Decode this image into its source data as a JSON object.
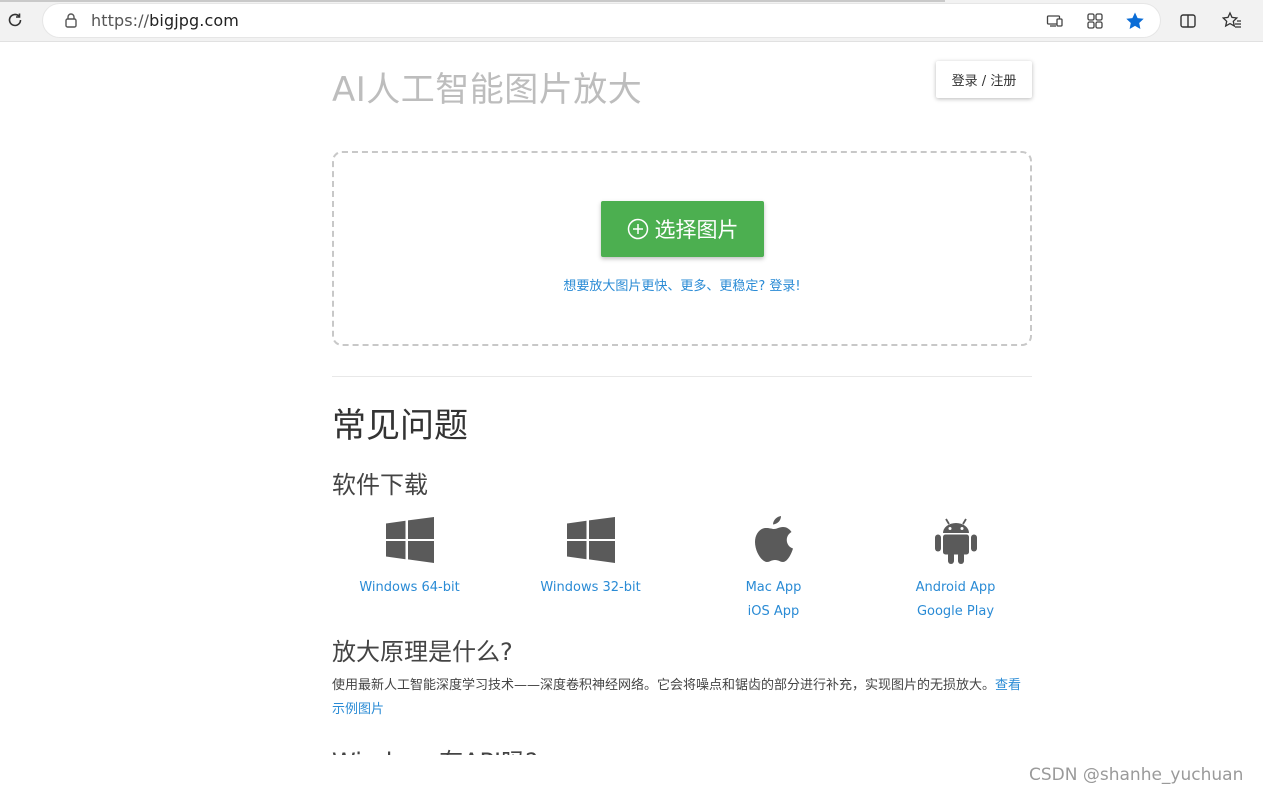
{
  "browser": {
    "url_scheme": "https://",
    "url_host": "bigjpg.com",
    "icons": [
      "reload-icon",
      "lock-icon",
      "cast-icon",
      "apps-icon",
      "star-icon",
      "split-screen-icon",
      "favorites-icon"
    ],
    "star_color": "#0a6cd6"
  },
  "header": {
    "title": "AI人工智能图片放大",
    "login_label": "登录 / 注册"
  },
  "upload": {
    "button_label": "选择图片",
    "button_icon": "add-circle-icon",
    "hint": "想要放大图片更快、更多、更稳定? 登录!",
    "button_color": "#4caf50"
  },
  "faq": {
    "heading": "常见问题",
    "download_heading": "软件下载",
    "downloads": [
      {
        "icon": "windows-icon",
        "links": [
          "Windows 64-bit"
        ]
      },
      {
        "icon": "windows-icon",
        "links": [
          "Windows 32-bit"
        ]
      },
      {
        "icon": "apple-icon",
        "links": [
          "Mac App",
          "iOS App"
        ]
      },
      {
        "icon": "android-icon",
        "links": [
          "Android App",
          "Google Play"
        ]
      }
    ],
    "principle_heading": "放大原理是什么?",
    "principle_text": "使用最新人工智能深度学习技术——深度卷积神经网络。它会将噪点和锯齿的部分进行补充，实现图片的无损放大。",
    "principle_link": "查看示例图片",
    "next_heading": "Windows有API吗?"
  },
  "watermark": "CSDN @shanhe_yuchuan",
  "link_color": "#2a8bd5"
}
